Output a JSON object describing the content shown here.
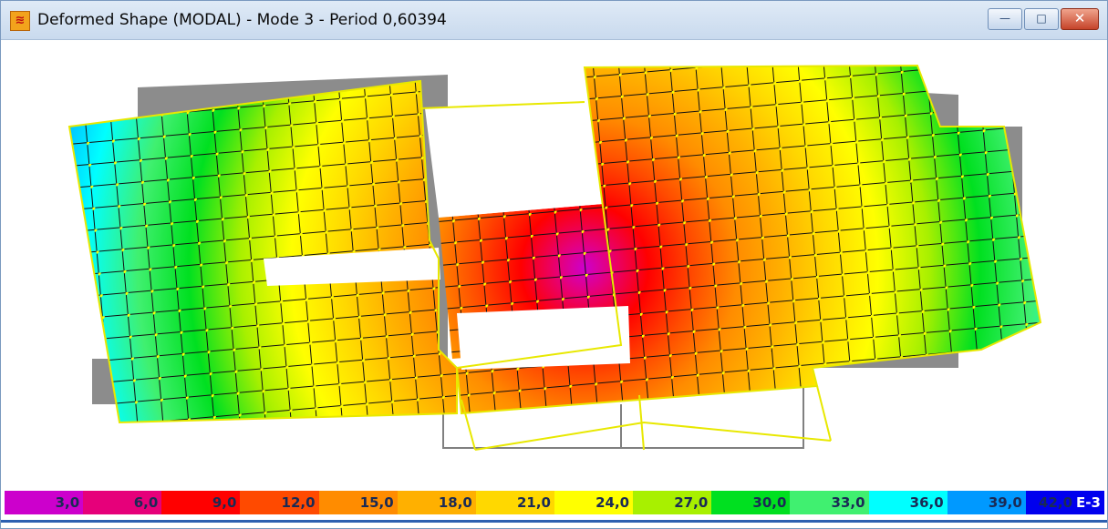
{
  "window": {
    "title": "Deformed Shape (MODAL) - Mode 3 - Period 0,60394",
    "icon": "app-logo-icon",
    "minimize_label": "—",
    "maximize_label": "□",
    "close_label": "✕"
  },
  "colors": {
    "mesh_line": "#111111",
    "nodes": "#ffff00",
    "undeformed": "#808080",
    "outline": "#e8e800"
  },
  "legend": {
    "colors": [
      "#cc00cc",
      "#e6007a",
      "#ff0000",
      "#ff4a00",
      "#ff8c00",
      "#ffb000",
      "#ffd800",
      "#ffff00",
      "#a8f000",
      "#00e020",
      "#40f070",
      "#00ffff",
      "#0099ff",
      "#0000ee"
    ],
    "labels": [
      "3,0",
      "6,0",
      "9,0",
      "12,0",
      "15,0",
      "18,0",
      "21,0",
      "24,0",
      "27,0",
      "30,0",
      "33,0",
      "36,0",
      "39,0",
      "42,0"
    ],
    "extra_label": "E-3"
  }
}
